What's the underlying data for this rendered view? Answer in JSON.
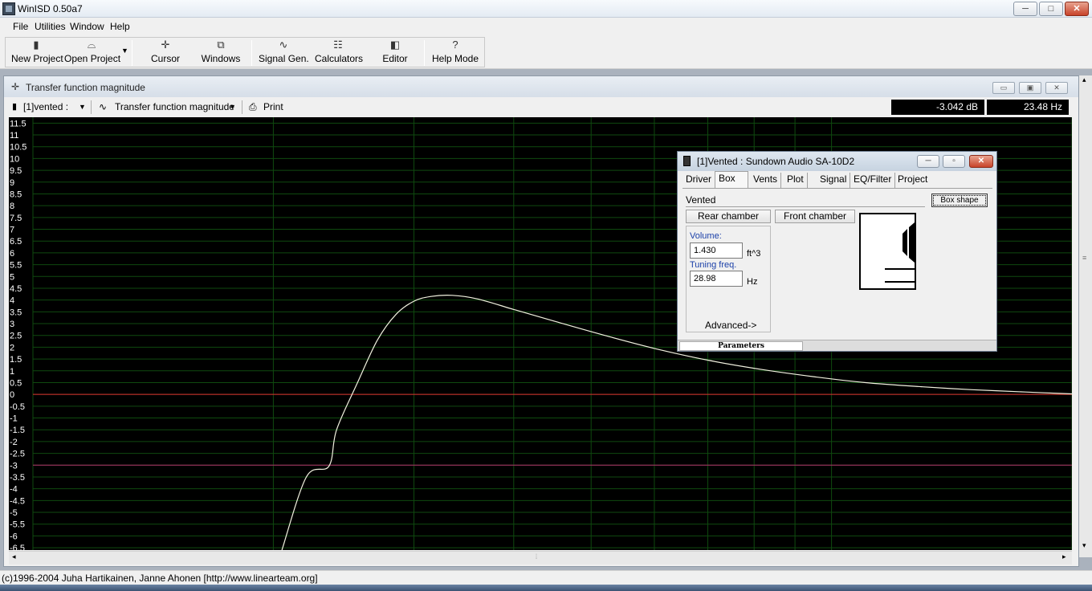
{
  "app": {
    "title": "WinISD 0.50a7",
    "caption_buttons": {
      "minimize": "─",
      "maximize": "□",
      "close": "✕"
    }
  },
  "menu": [
    {
      "label": "File"
    },
    {
      "label": "Utilities"
    },
    {
      "label": "Window"
    },
    {
      "label": "Help"
    }
  ],
  "toolbar": {
    "new_project": "New Project",
    "open_project": "Open Project",
    "cursor": "Cursor",
    "windows": "Windows",
    "signal_gen": "Signal Gen.",
    "calculators": "Calculators",
    "editor": "Editor",
    "help_mode": "Help Mode"
  },
  "plot_window": {
    "title": "Transfer function magnitude",
    "project_select": "[1]vented :",
    "plot_select": "Transfer function magnitude",
    "print_label": "Print",
    "readout_db": "-3.042 dB",
    "readout_hz": "23.48 Hz"
  },
  "chart_data": {
    "type": "line",
    "title": "Transfer function magnitude",
    "ylabel": "",
    "xlabel": "",
    "y_ticks": [
      "11.5",
      "11",
      "10.5",
      "10",
      "9.5",
      "9",
      "8.5",
      "8",
      "7.5",
      "7",
      "6.5",
      "6",
      "5.5",
      "5",
      "4.5",
      "4",
      "3.5",
      "3",
      "2.5",
      "2",
      "1.5",
      "1",
      "0.5",
      "0",
      "-0.5",
      "-1",
      "-1.5",
      "-2",
      "-2.5",
      "-3",
      "-3.5",
      "-4",
      "-4.5",
      "-5",
      "-5.5",
      "-6",
      "-6.5"
    ],
    "ylim": [
      -6.6,
      11.75
    ],
    "x_scale": "log",
    "xlim_hz": [
      10,
      200
    ],
    "grid": true,
    "reference_lines": [
      {
        "y": 0,
        "color": "#e03030"
      },
      {
        "y": -3,
        "color": "#b0306a"
      }
    ],
    "series": [
      {
        "color": "#f2f2e0",
        "points_hz_db": [
          [
            20.5,
            -6.6
          ],
          [
            22,
            -3.5
          ],
          [
            23.48,
            -3.042
          ],
          [
            24,
            -1.5
          ],
          [
            25.5,
            0.5
          ],
          [
            27,
            2.3
          ],
          [
            28.5,
            3.4
          ],
          [
            30,
            3.95
          ],
          [
            31.5,
            4.15
          ],
          [
            33.5,
            4.2
          ],
          [
            36,
            4.05
          ],
          [
            40,
            3.6
          ],
          [
            45,
            3.1
          ],
          [
            52,
            2.5
          ],
          [
            60,
            1.95
          ],
          [
            70,
            1.45
          ],
          [
            82,
            1.05
          ],
          [
            95,
            0.75
          ],
          [
            110,
            0.5
          ],
          [
            130,
            0.32
          ],
          [
            150,
            0.2
          ],
          [
            175,
            0.1
          ],
          [
            200,
            0.02
          ]
        ]
      }
    ]
  },
  "box_window": {
    "title": "[1]Vented : Sundown Audio SA-10D2",
    "tabs": [
      "Driver",
      "Box",
      "Vents",
      "Plot",
      "Signal",
      "EQ/Filter",
      "Project"
    ],
    "active_tab": "Box",
    "box_type": "Vented",
    "box_shape_label": "Box shape",
    "rear_chamber": "Rear chamber",
    "front_chamber": "Front chamber",
    "volume_label": "Volume:",
    "volume_value": "1.430",
    "volume_unit": "ft^3",
    "tuning_label": "Tuning freq.",
    "tuning_value": "28.98",
    "tuning_unit": "Hz",
    "advanced": "Advanced->",
    "status_label": "Parameters"
  },
  "status": {
    "text": "(c)1996-2004 Juha Hartikainen, Janne Ahonen [http://www.linearteam.org]"
  }
}
